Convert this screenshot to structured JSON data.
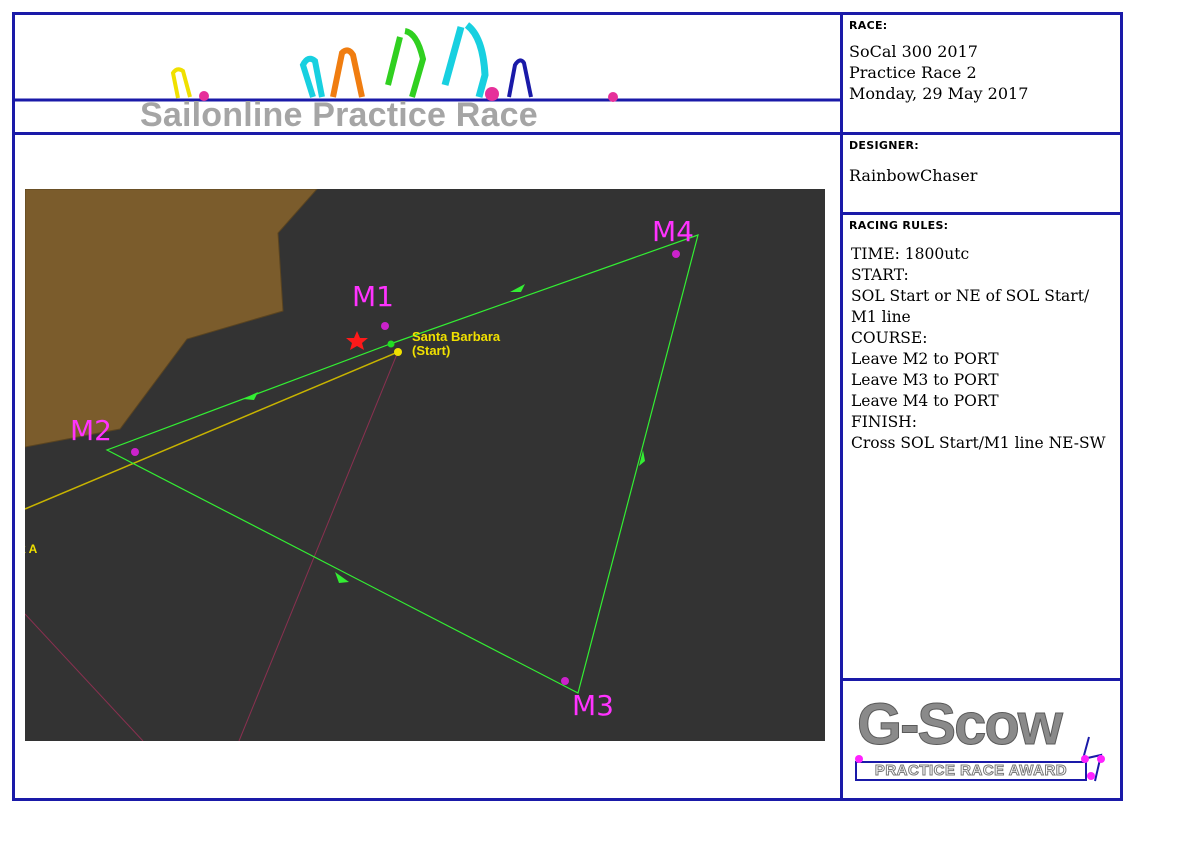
{
  "header": {
    "title": "Sailonline Practice Race"
  },
  "race": {
    "label": "RACE:",
    "lines": [
      "SoCal 300 2017",
      "Practice Race 2",
      "Monday, 29 May  2017"
    ]
  },
  "designer": {
    "label": "DESIGNER:",
    "name": "RainbowChaser"
  },
  "rules": {
    "label": "RACING RULES:",
    "lines": [
      "TIME: 1800utc",
      "",
      "START:",
      "SOL Start or NE of SOL Start/",
      "M1 line",
      "",
      "COURSE:",
      "Leave M2 to PORT",
      "Leave M3 to PORT",
      "Leave M4 to PORT",
      "",
      "FINISH:",
      "Cross SOL Start/M1 line NE-SW"
    ]
  },
  "map": {
    "start_label_1": "Santa Barbara",
    "start_label_2": "(Start)",
    "edge_label": "k A",
    "marks": [
      "M1",
      "M2",
      "M3",
      "M4"
    ]
  },
  "award": {
    "title": "G-Scow",
    "subtitle": "PRACTICE RACE AWARD"
  },
  "colors": {
    "frame": "#1a1aa8",
    "course_line": "#33ee33",
    "start_line": "#c8b400",
    "mark_label": "#ff33ff",
    "mark_dot": "#cc22cc",
    "land": "#7b5c2c",
    "sea": "#333333",
    "title_gray": "#a5a5a5"
  }
}
